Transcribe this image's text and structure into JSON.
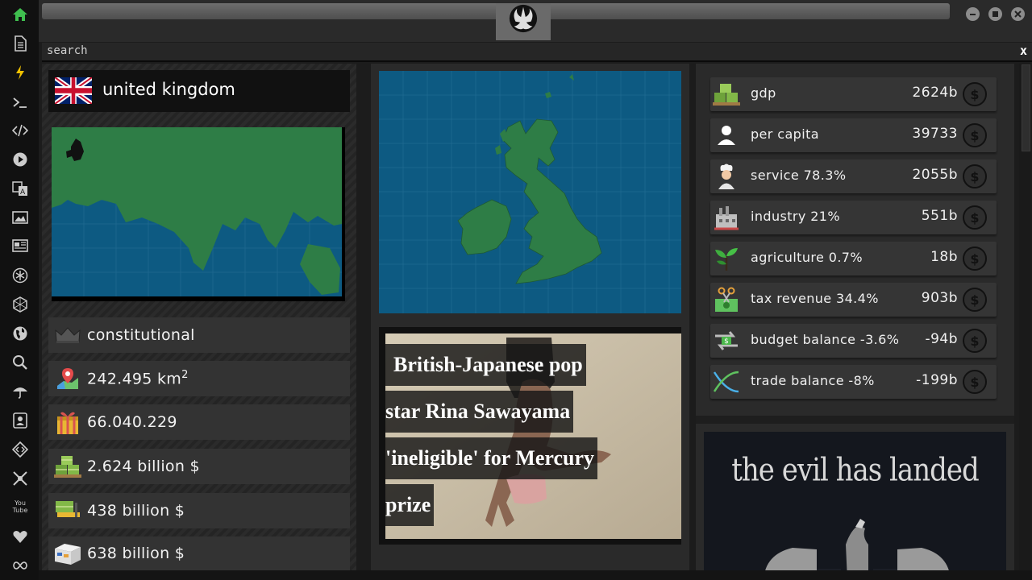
{
  "window": {
    "search_label": "search",
    "close_label": "x"
  },
  "sidebar": {
    "icons": [
      "home-icon",
      "document-icon",
      "lightning-icon",
      "terminal-icon",
      "code-icon",
      "play-icon",
      "translate-icon",
      "image-icon",
      "news-icon",
      "asterisk-icon",
      "hexagon-icon",
      "globe-icon",
      "search-icon",
      "umbrella-icon",
      "contact-card-icon",
      "diamond-code-icon",
      "crosshair-icon",
      "youtube-icon",
      "heart-icon",
      "infinity-icon"
    ],
    "youtube_label": "You Tube"
  },
  "country": {
    "name": "united kingdom",
    "government": "constitutional",
    "area_value": "242.495 km",
    "area_sup": "2",
    "population": "66.040.229",
    "gdp": "2.624 billion $",
    "revenue": "438 billion $",
    "exports": "638 billion $"
  },
  "stats": [
    {
      "label": "gdp",
      "value": "2624b",
      "icon": "money-pallet-icon"
    },
    {
      "label": "per capita",
      "value": "39733",
      "icon": "person-icon"
    },
    {
      "label": "service 78.3%",
      "value": "2055b",
      "icon": "chef-icon"
    },
    {
      "label": "industry 21%",
      "value": "551b",
      "icon": "factory-icon"
    },
    {
      "label": "agriculture 0.7%",
      "value": "18b",
      "icon": "plant-icon"
    },
    {
      "label": "tax revenue 34.4%",
      "value": "903b",
      "icon": "scissors-money-icon"
    },
    {
      "label": "budget balance -3.6%",
      "value": "-94b",
      "icon": "exchange-money-icon"
    },
    {
      "label": "trade balance -8%",
      "value": "-199b",
      "icon": "trade-cross-icon"
    }
  ],
  "currency_symbol": "$",
  "news": {
    "lines": [
      "British-Japanese pop",
      "star Rina Sawayama",
      "'ineligible' for Mercury",
      "prize"
    ]
  },
  "promo": {
    "title": "the evil has landed"
  },
  "colors": {
    "land": "#2e7d46",
    "sea": "#0d5a82",
    "accent_green": "#3fbf4f"
  }
}
